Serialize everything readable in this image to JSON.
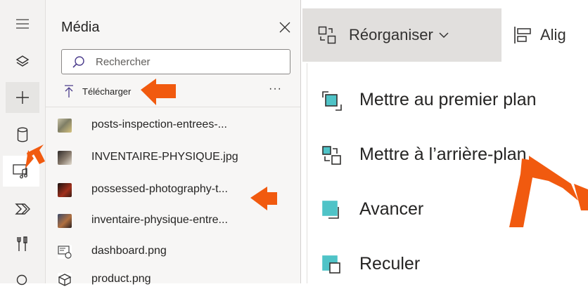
{
  "rail": {
    "items": [
      {
        "icon": "hamburger-icon"
      },
      {
        "icon": "layers-icon"
      },
      {
        "icon": "plus-icon"
      },
      {
        "icon": "database-icon"
      },
      {
        "icon": "media-icon"
      },
      {
        "icon": "power-automate-icon"
      },
      {
        "icon": "tools-icon"
      },
      {
        "icon": "search-icon"
      }
    ]
  },
  "media_pane": {
    "title": "Média",
    "search_placeholder": "Rechercher",
    "upload_label": "Télécharger",
    "more_label": "···",
    "files": [
      {
        "name": "posts-inspection-entrees-...",
        "thumb_color": "#8c8f7a"
      },
      {
        "name": "INVENTAIRE-PHYSIQUE.jpg",
        "thumb_color": "#5a5048"
      },
      {
        "name": "possessed-photography-t...",
        "thumb_color": "#7a2a1e"
      },
      {
        "name": "inventaire-physique-entre...",
        "thumb_color": "#6b4a3a"
      },
      {
        "name": "dashboard.png",
        "thumb_color": "#9a9a9a"
      },
      {
        "name": "product.png",
        "thumb_color": "#4a4a4a"
      }
    ]
  },
  "toolbar": {
    "reorganize_label": "Réorganiser",
    "align_label": "Alig"
  },
  "menu": {
    "items": [
      {
        "label": "Mettre au premier plan",
        "icon": "bring-to-front-icon"
      },
      {
        "label": "Mettre à l’arrière-plan",
        "icon": "send-to-back-icon"
      },
      {
        "label": "Avancer",
        "icon": "bring-forward-icon"
      },
      {
        "label": "Reculer",
        "icon": "send-backward-icon"
      }
    ]
  },
  "colors": {
    "accent_teal": "#4fc3c7",
    "annotation_orange": "#f15a0f"
  }
}
